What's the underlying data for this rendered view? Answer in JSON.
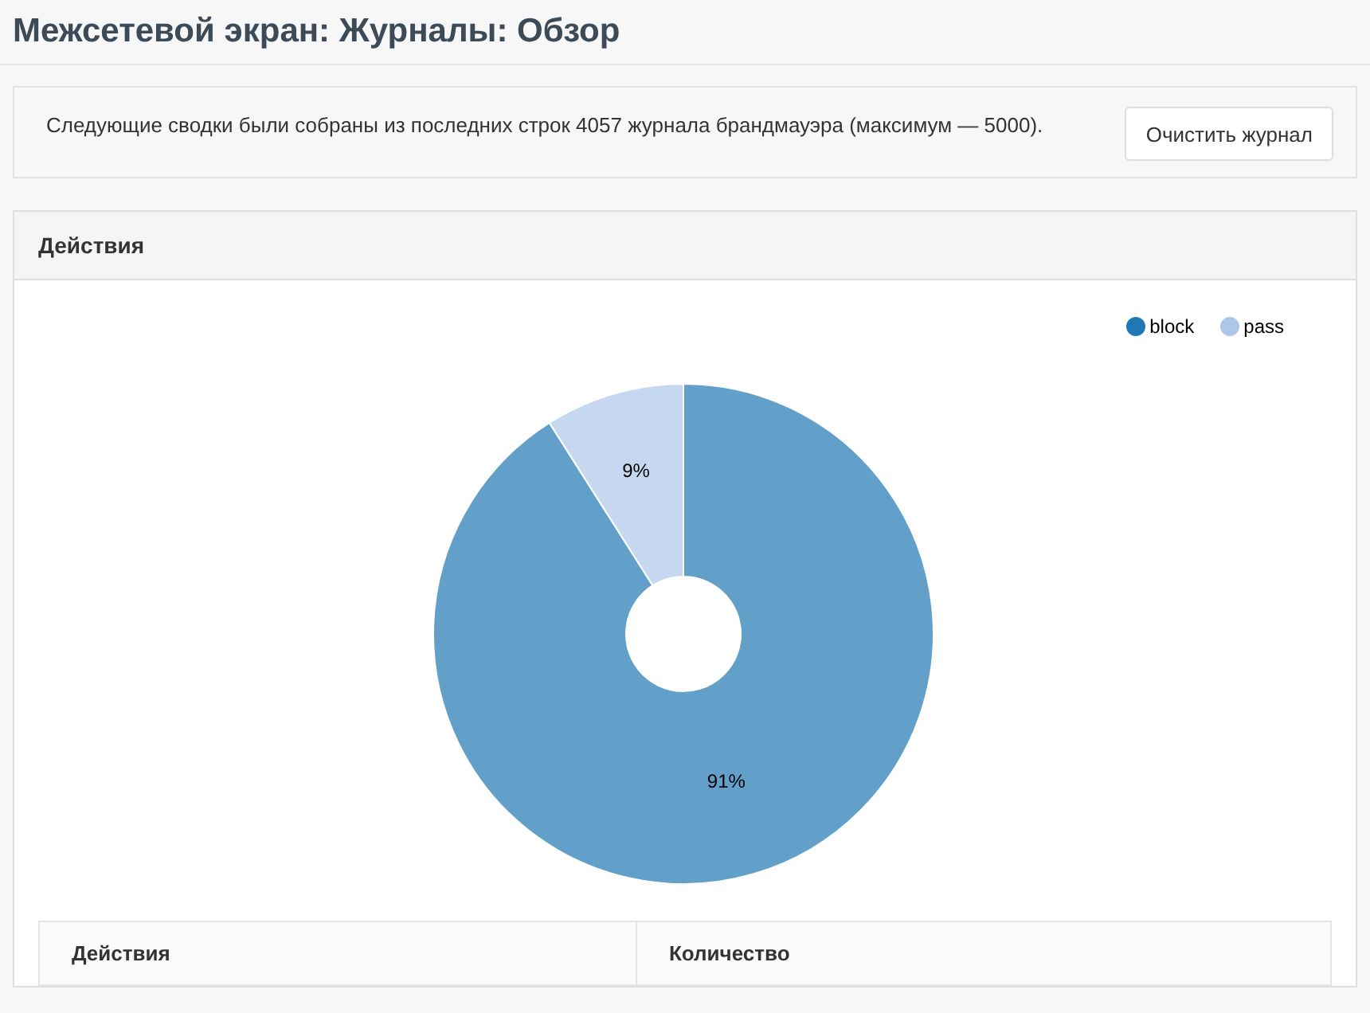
{
  "page": {
    "title": "Межсетевой экран: Журналы: Обзор"
  },
  "notice": {
    "text": "Следующие сводки были собраны из последних строк 4057 журнала брандмауэра (максимум — 5000).",
    "button": "Очистить журнал"
  },
  "panel": {
    "title": "Действия",
    "chart_data": {
      "type": "donut",
      "categories": [
        "block",
        "pass"
      ],
      "series": [
        {
          "values": [
            91,
            9
          ]
        }
      ],
      "colors": [
        "#1f77b4",
        "#aec7e8"
      ],
      "value_labels": [
        "91%",
        "9%"
      ],
      "legend": "top-right"
    },
    "table": {
      "columns": [
        "Действия",
        "Количество"
      ]
    }
  }
}
